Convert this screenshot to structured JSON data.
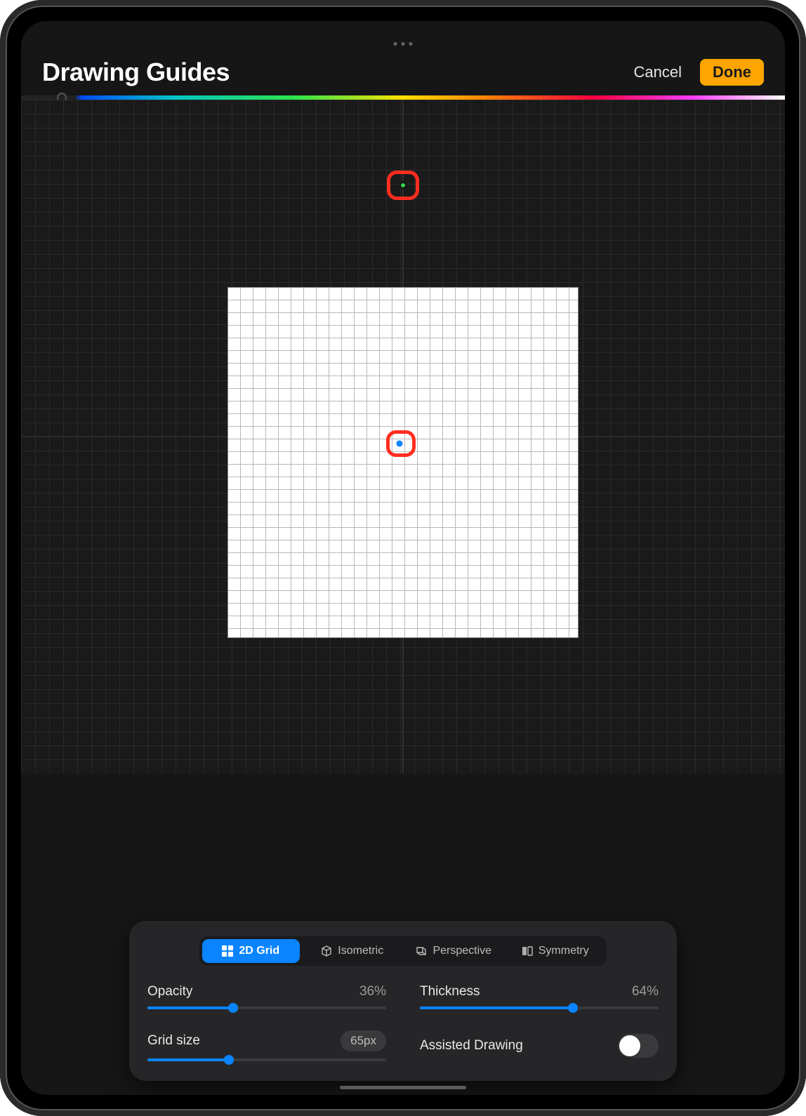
{
  "header": {
    "title": "Drawing Guides",
    "cancel": "Cancel",
    "done": "Done"
  },
  "hue_slider": {
    "value_pct": 7
  },
  "canvas": {
    "top_handle_color": "#39d353",
    "center_handle_color": "#0a84ff"
  },
  "panel": {
    "tabs": [
      {
        "id": "2d_grid",
        "label": "2D Grid",
        "active": true
      },
      {
        "id": "isometric",
        "label": "Isometric",
        "active": false
      },
      {
        "id": "perspective",
        "label": "Perspective",
        "active": false
      },
      {
        "id": "symmetry",
        "label": "Symmetry",
        "active": false
      }
    ],
    "opacity": {
      "label": "Opacity",
      "value_text": "36%",
      "value_pct": 36
    },
    "thickness": {
      "label": "Thickness",
      "value_text": "64%",
      "value_pct": 64
    },
    "grid_size": {
      "label": "Grid size",
      "value_text": "65px",
      "value_pct": 34
    },
    "assisted": {
      "label": "Assisted Drawing",
      "on": false
    }
  },
  "annotations": {
    "top_callout_target": "grid-origin-handle",
    "mid_callout_target": "canvas-center-handle"
  }
}
